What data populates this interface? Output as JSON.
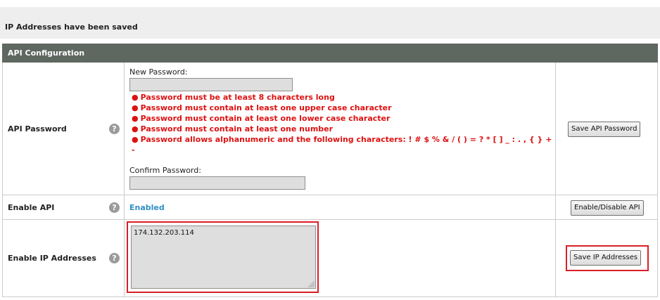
{
  "notice": {
    "message": "IP Addresses have been saved"
  },
  "panel": {
    "title": "API Configuration"
  },
  "password_row": {
    "label": "API Password",
    "help_icon": "?",
    "new_password_label": "New Password:",
    "new_password_value": "",
    "confirm_password_label": "Confirm Password:",
    "confirm_password_value": "",
    "rules": [
      "Password must be at least 8 characters long",
      "Password must contain at least one upper case character",
      "Password must contain at least one lower case character",
      "Password must contain at least one number",
      "Password allows alphanumeric and the following characters: ! # $ % & / ( ) = ? * [ ] _ : . , { } + -"
    ],
    "save_button": "Save API Password"
  },
  "api_row": {
    "label": "Enable API",
    "help_icon": "?",
    "status": "Enabled",
    "toggle_button": "Enable/Disable API"
  },
  "ip_row": {
    "label": "Enable IP Addresses",
    "help_icon": "?",
    "ip_value": "174.132.203.114",
    "save_button": "Save IP Addresses"
  },
  "colors": {
    "header_bg": "#5f6761",
    "rule_text": "#dd1111",
    "status_enabled": "#2f8fc4",
    "highlight": "#d91f26"
  }
}
